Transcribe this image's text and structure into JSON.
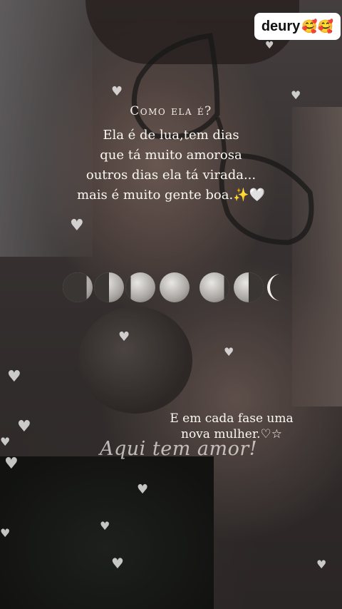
{
  "badge": {
    "name": "deury",
    "emoji": "🥰🥰"
  },
  "caption": {
    "title": "Como ela é?",
    "lines": [
      "Ela é de lua,tem dias",
      "que tá muito amorosa",
      "outros dias ela tá virada...",
      "mais é muito gente boa.✨🤍"
    ]
  },
  "moon_phases": [
    "waning-crescent",
    "last-quarter",
    "waning-gibbous",
    "full",
    "waxing-gibbous",
    "first-quarter",
    "waxing-crescent"
  ],
  "second_caption": {
    "lines": [
      "E em cada fase uma",
      "nova mulher.♡☆"
    ]
  },
  "script_text": "Aqui tem amor!",
  "colors": {
    "text": "#fbf8f2",
    "badge_bg": "#ffffff",
    "hearts": "#ffffff"
  }
}
